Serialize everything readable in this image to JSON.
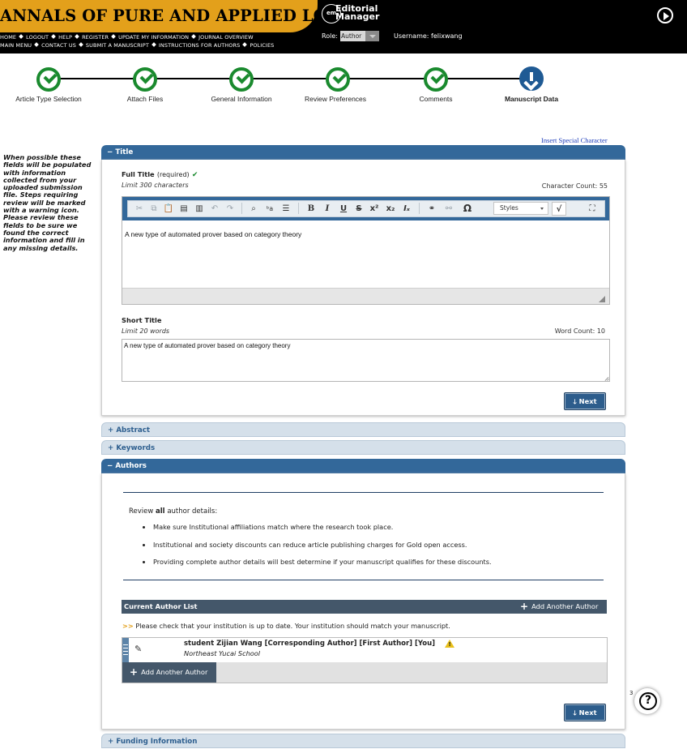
{
  "header": {
    "journal_title": "ANNALS OF PURE AND APPLIED LOGIC",
    "nav_line1": [
      "HOME",
      "LOGOUT",
      "HELP",
      "REGISTER",
      "UPDATE MY INFORMATION",
      "JOURNAL OVERVIEW"
    ],
    "nav_line2": [
      "MAIN MENU",
      "CONTACT US",
      "SUBMIT A MANUSCRIPT",
      "INSTRUCTIONS FOR AUTHORS",
      "POLICIES"
    ],
    "logo_mark": "em",
    "logo_line1": "Editorial",
    "logo_line2": "Manager",
    "role_label": "Role:",
    "role_value": "Author",
    "username_text": "Username: felixwang",
    "colors": {
      "brand": "#e3a01b",
      "bar": "#000000"
    }
  },
  "steps": [
    {
      "label": "Article Type Selection",
      "state": "done"
    },
    {
      "label": "Attach Files",
      "state": "done"
    },
    {
      "label": "General Information",
      "state": "done"
    },
    {
      "label": "Review Preferences",
      "state": "done"
    },
    {
      "label": "Comments",
      "state": "done"
    },
    {
      "label": "Manuscript Data",
      "state": "current"
    }
  ],
  "sidebar_note": "When possible these fields will be populated with information collected from your uploaded submission file. Steps requiring review will be marked with a warning icon. Please review these fields to be sure we found the correct information and fill in any missing details.",
  "insert_special": "Insert Special Character",
  "title_panel": {
    "header": "Title",
    "toggle": "−",
    "full_title_label": "Full Title",
    "required_text": "(required)",
    "check": "✔",
    "limit": "Limit 300 characters",
    "count": "Character Count: 55",
    "value": "A new type of automated prover based on category theory",
    "styles_label": "Styles",
    "short_title_label": "Short Title",
    "short_limit": "Limit 20 words",
    "word_count": "Word Count: 10",
    "short_value": "A new type of automated prover based on category theory",
    "next": "Next"
  },
  "toolbar_icons": [
    "cut-icon",
    "copy-icon",
    "paste-icon",
    "paste-text-icon",
    "paste-word-icon",
    "undo-icon",
    "redo-icon",
    "find-icon",
    "replace-icon",
    "select-all-icon",
    "bold-icon",
    "italic-icon",
    "underline-icon",
    "strike-icon",
    "superscript-icon",
    "subscript-icon",
    "remove-format-icon",
    "link-icon",
    "unlink-icon",
    "special-char-icon",
    "math-icon",
    "maximize-icon"
  ],
  "collapsed_panels": {
    "abstract": "Abstract",
    "keywords": "Keywords",
    "funding": "Funding Information",
    "plus": "+"
  },
  "authors_panel": {
    "header": "Authors",
    "toggle": "−",
    "review_prefix": "Review",
    "review_bold": "all",
    "review_suffix": "author details:",
    "bullets": [
      "Make sure Institutional affiliations match where the research took place.",
      "Institutional and society discounts can reduce article publishing charges for Gold open access.",
      "Providing complete author details will best determine if your manuscript qualifies for these discounts."
    ],
    "list_title": "Current Author List",
    "add_another": "Add Another Author",
    "inst_marker": ">>",
    "inst_note": "Please check that your institution is up to date. Your institution should match your manuscript.",
    "author_name": "student Zijian Wang [Corresponding Author] [First Author] [You]",
    "author_inst": "Northeast Yucai School",
    "next": "Next"
  },
  "help": {
    "count": "3",
    "symbol": "?"
  }
}
